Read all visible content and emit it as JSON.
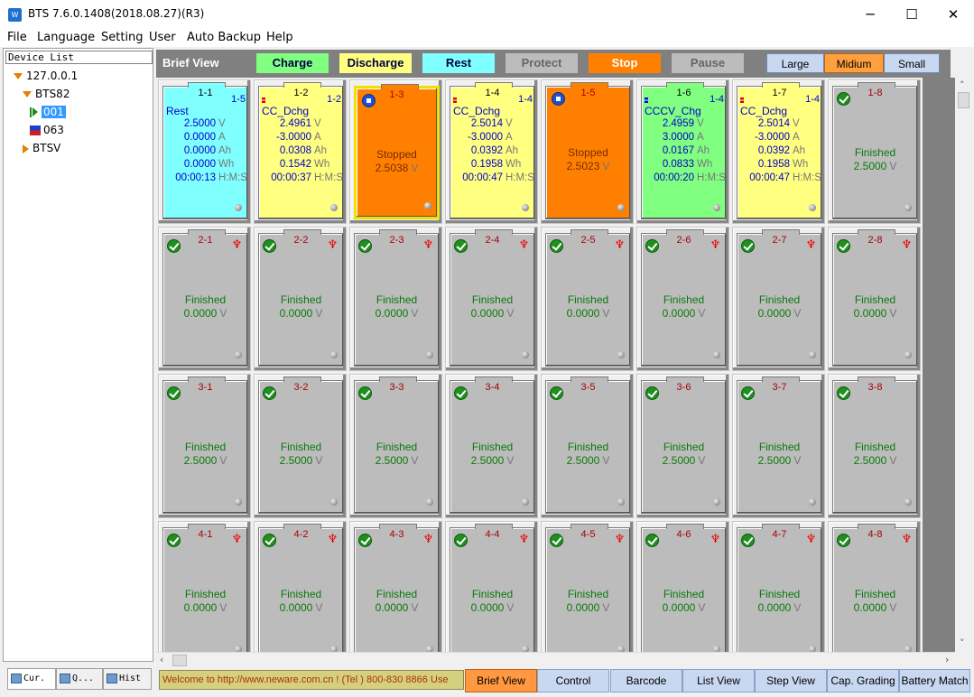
{
  "window": {
    "title": "BTS 7.6.0.1408(2018.08.27)(R3)",
    "min": "─",
    "max": "☐",
    "close": "✕"
  },
  "menu": [
    "File",
    "Language",
    "Setting",
    "User",
    "Auto Backup",
    "Help"
  ],
  "device_list": {
    "header": "Device List",
    "nodes": [
      "127.0.0.1",
      "BTS82",
      "001",
      "063",
      "BTSV"
    ]
  },
  "left_tabs": [
    "Cur.",
    "Q...",
    "Hist"
  ],
  "toolbar": {
    "title": "Brief View",
    "legend": [
      {
        "label": "Charge",
        "color": "#80ff80"
      },
      {
        "label": "Discharge",
        "color": "#ffff80"
      },
      {
        "label": "Rest",
        "color": "#80ffff"
      },
      {
        "label": "Protect",
        "color": "#bcbcbc"
      },
      {
        "label": "Stop",
        "color": "#ff8000"
      },
      {
        "label": "Pause",
        "color": "#bcbcbc"
      }
    ],
    "sizes": [
      "Large",
      "Midium",
      "Small"
    ],
    "active_size": "Midium"
  },
  "channels_row1": [
    {
      "id": "1-1",
      "total": "1-5",
      "color": "#80ffff",
      "step": "Rest",
      "rows": [
        [
          "2.5000",
          "V"
        ],
        [
          "0.0000",
          "A"
        ],
        [
          "0.0000",
          "Ah"
        ],
        [
          "0.0000",
          "Wh"
        ],
        [
          "00:00:13",
          "H:M:S"
        ]
      ]
    },
    {
      "id": "1-2",
      "total": "1-2",
      "color": "#ffff80",
      "step": "CC_Dchg",
      "mark": "red",
      "rows": [
        [
          "2.4961",
          "V"
        ],
        [
          "-3.0000",
          "A"
        ],
        [
          "0.0308",
          "Ah"
        ],
        [
          "0.1542",
          "Wh"
        ],
        [
          "00:00:37",
          "H:M:S"
        ]
      ]
    },
    {
      "id": "1-3",
      "color": "#ff8000",
      "status": "Stopped",
      "voltage": "2.5038",
      "unit": "V",
      "selected": true
    },
    {
      "id": "1-4",
      "total": "1-4",
      "color": "#ffff80",
      "step": "CC_Dchg",
      "mark": "red",
      "rows": [
        [
          "2.5014",
          "V"
        ],
        [
          "-3.0000",
          "A"
        ],
        [
          "0.0392",
          "Ah"
        ],
        [
          "0.1958",
          "Wh"
        ],
        [
          "00:00:47",
          "H:M:S"
        ]
      ]
    },
    {
      "id": "1-5",
      "color": "#ff8000",
      "status": "Stopped",
      "voltage": "2.5023",
      "unit": "V"
    },
    {
      "id": "1-6",
      "total": "1-4",
      "color": "#80ff80",
      "step": "CCCV_Chg",
      "mark": "blue",
      "rows": [
        [
          "2.4959",
          "V"
        ],
        [
          "3.0000",
          "A"
        ],
        [
          "0.0167",
          "Ah"
        ],
        [
          "0.0833",
          "Wh"
        ],
        [
          "00:00:20",
          "H:M:S"
        ]
      ]
    },
    {
      "id": "1-7",
      "total": "1-4",
      "color": "#ffff80",
      "step": "CC_Dchg",
      "mark": "red",
      "rows": [
        [
          "2.5014",
          "V"
        ],
        [
          "-3.0000",
          "A"
        ],
        [
          "0.0392",
          "Ah"
        ],
        [
          "0.1958",
          "Wh"
        ],
        [
          "00:00:47",
          "H:M:S"
        ]
      ]
    },
    {
      "id": "1-8",
      "color": "#bcbcbc",
      "status": "Finished",
      "voltage": "2.5000",
      "unit": "V",
      "check": true
    }
  ],
  "finished_rows": [
    {
      "prefix": "2",
      "voltage": "0.0000",
      "warn": true
    },
    {
      "prefix": "3",
      "voltage": "2.5000",
      "warn": false
    },
    {
      "prefix": "4",
      "voltage": "0.0000",
      "warn": true
    }
  ],
  "finished_label": "Finished",
  "volt_unit": "V",
  "status_text": "Welcome to http://www.neware.com.cn !    (Tel ) 800-830 8866  Use",
  "bottom_tabs": [
    "Brief View",
    "Control",
    "Barcode",
    "List View",
    "Step View",
    "Cap. Grading",
    "Battery Match"
  ],
  "active_bottom_tab": "Brief View"
}
